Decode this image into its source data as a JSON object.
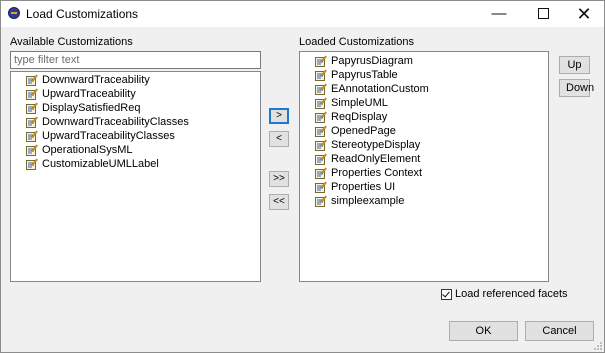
{
  "window": {
    "title": "Load Customizations"
  },
  "available": {
    "label": "Available Customizations",
    "filter_placeholder": "type filter text",
    "items": [
      "DownwardTraceability",
      "UpwardTraceability",
      "DisplaySatisfiedReq",
      "DownwardTraceabilityClasses",
      "UpwardTraceabilityClasses",
      "OperationalSysML",
      "CustomizableUMLLabel"
    ]
  },
  "loaded": {
    "label": "Loaded Customizations",
    "items": [
      "PapyrusDiagram",
      "PapyrusTable",
      "EAnnotationCustom",
      "SimpleUML",
      "ReqDisplay",
      "OpenedPage",
      "StereotypeDisplay",
      "ReadOnlyElement",
      "Properties Context",
      "Properties UI",
      "simpleexample"
    ]
  },
  "move_buttons": {
    "add": ">",
    "remove": "<",
    "add_all": ">>",
    "remove_all": "<<"
  },
  "order_buttons": {
    "up": "Up",
    "down": "Down"
  },
  "options": {
    "load_referenced_facets": "Load referenced facets",
    "load_referenced_facets_checked": true
  },
  "footer": {
    "ok": "OK",
    "cancel": "Cancel"
  }
}
